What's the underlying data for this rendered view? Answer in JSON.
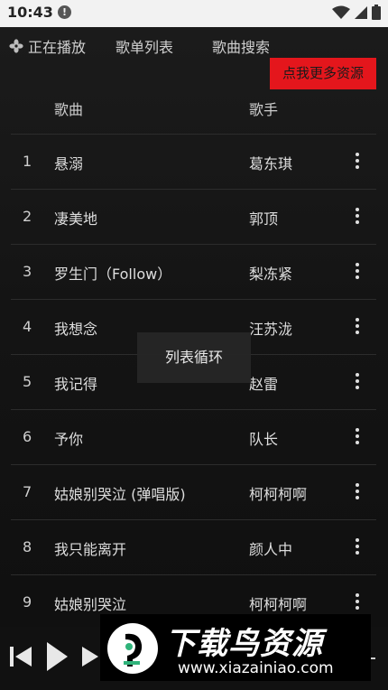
{
  "status_bar": {
    "time": "10:43",
    "alert_glyph": "!"
  },
  "nav": {
    "now_playing": "正在播放",
    "playlists": "歌单列表",
    "song_search": "歌曲搜索",
    "promo_button": "点我更多资源"
  },
  "table": {
    "header_song": "歌曲",
    "header_artist": "歌手",
    "rows": [
      {
        "num": "1",
        "title": "悬溺",
        "artist": "葛东琪"
      },
      {
        "num": "2",
        "title": "凄美地",
        "artist": "郭顶"
      },
      {
        "num": "3",
        "title": "罗生门（Follow）",
        "artist": "梨冻紧"
      },
      {
        "num": "4",
        "title": "我想念",
        "artist": "汪苏泷"
      },
      {
        "num": "5",
        "title": "我记得",
        "artist": "赵雷"
      },
      {
        "num": "6",
        "title": "予你",
        "artist": "队长"
      },
      {
        "num": "7",
        "title": "姑娘别哭泣 (弹唱版)",
        "artist": "柯柯柯啊"
      },
      {
        "num": "8",
        "title": "我只能离开",
        "artist": "颜人中"
      },
      {
        "num": "9",
        "title": "姑娘别哭泣",
        "artist": "柯柯柯啊"
      }
    ]
  },
  "toast": {
    "text": "列表循环"
  },
  "watermark": {
    "title": "下载鸟资源",
    "url": "www.xiazainiao.com"
  },
  "colors": {
    "promo_red": "#e4161c",
    "background": "#141414",
    "divider": "#2c2c2c"
  }
}
